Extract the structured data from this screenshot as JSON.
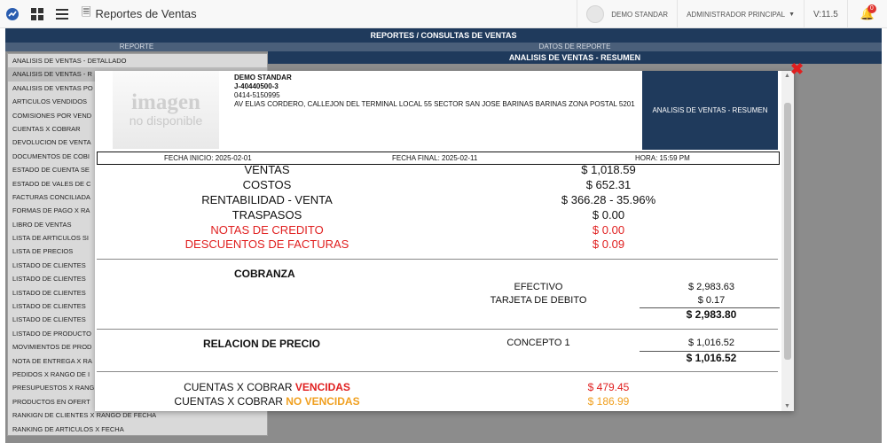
{
  "topbar": {
    "title": "Reportes de Ventas",
    "company": "DEMO STANDAR",
    "user": "ADMINISTRADOR PRINCIPAL",
    "version": "V:11.5",
    "notifications": "0"
  },
  "background": {
    "header": "REPORTES / CONSULTAS DE VENTAS",
    "col_reporte": "REPORTE",
    "col_datos": "DATOS DE REPORTE",
    "data_title": "ANALISIS DE VENTAS - RESUMEN",
    "reports": [
      "ANALISIS DE VENTAS - DETALLADO",
      "ANALISIS DE VENTAS - R",
      "ANALISIS DE VENTAS PO",
      "ARTICULOS VENDIDOS",
      "COMISIONES POR VEND",
      "CUENTAS X COBRAR",
      "DEVOLUCION DE VENTA",
      "DOCUMENTOS DE COBI",
      "ESTADO DE CUENTA SE",
      "ESTADO DE VALES DE C",
      "FACTURAS CONCILIADA",
      "FORMAS DE PAGO X RA",
      "LIBRO DE VENTAS",
      "LISTA DE ARTICULOS SI",
      "LISTA DE PRECIOS",
      "LISTADO DE CLIENTES",
      "LISTADO DE CLIENTES",
      "LISTADO DE CLIENTES",
      "LISTADO DE CLIENTES",
      "LISTADO DE CLIENTES",
      "LISTADO DE PRODUCTO",
      "MOVIMIENTOS DE PROD",
      "NOTA DE ENTREGA X RA",
      "PEDIDOS X RANGO DE I",
      "PRESUPUESTOS X RANG",
      "PRODUCTOS EN OFERT",
      "RANKIGN DE CLIENTES X RANGO DE FECHA",
      "RANKING DE ARTICULOS X FECHA"
    ]
  },
  "modal": {
    "logo_line1": "imagen",
    "logo_line2": "no disponible",
    "company_name": "DEMO STANDAR",
    "rif": "J-40440500-3",
    "phone": "0414-5150995",
    "address": "AV ELIAS CORDERO, CALLEJON DEL TERMINAL LOCAL 55 SECTOR SAN JOSE BARINAS BARINAS ZONA POSTAL 5201",
    "report_title": "ANALISIS DE VENTAS - RESUMEN",
    "fecha_inicio": "FECHA INICIO: 2025-02-01",
    "fecha_final": "FECHA FINAL: 2025-02-11",
    "hora": "HORA: 15:59 PM",
    "summary": {
      "ventas_label": "VENTAS",
      "ventas_value": "$ 1,018.59",
      "costos_label": "COSTOS",
      "costos_value": "$ 652.31",
      "rent_label": "RENTABILIDAD - VENTA",
      "rent_value": "$ 366.28 - 35.96%",
      "trasp_label": "TRASPASOS",
      "trasp_value": "$ 0.00",
      "notas_label": "NOTAS DE CREDITO",
      "notas_value": "$ 0.00",
      "desc_label": "DESCUENTOS DE FACTURAS",
      "desc_value": "$ 0.09"
    },
    "cobranza": {
      "title": "COBRANZA",
      "efectivo_label": "EFECTIVO",
      "efectivo_value": "$ 2,983.63",
      "debito_label": "TARJETA DE DEBITO",
      "debito_value": "$ 0.17",
      "total": "$ 2,983.80"
    },
    "precio": {
      "title": "RELACION DE PRECIO",
      "concepto_label": "CONCEPTO 1",
      "concepto_value": "$ 1,016.52",
      "total": "$ 1,016.52"
    },
    "cuentas": {
      "prefix": "CUENTAS X COBRAR",
      "vencidas": "VENCIDAS",
      "vencidas_value": "$ 479.45",
      "no_vencidas": "NO VENCIDAS",
      "no_vencidas_value": "$ 186.99"
    }
  },
  "colors": {
    "navy": "#1f3a5c",
    "red": "#e01f1f",
    "orange": "#f0a020"
  }
}
